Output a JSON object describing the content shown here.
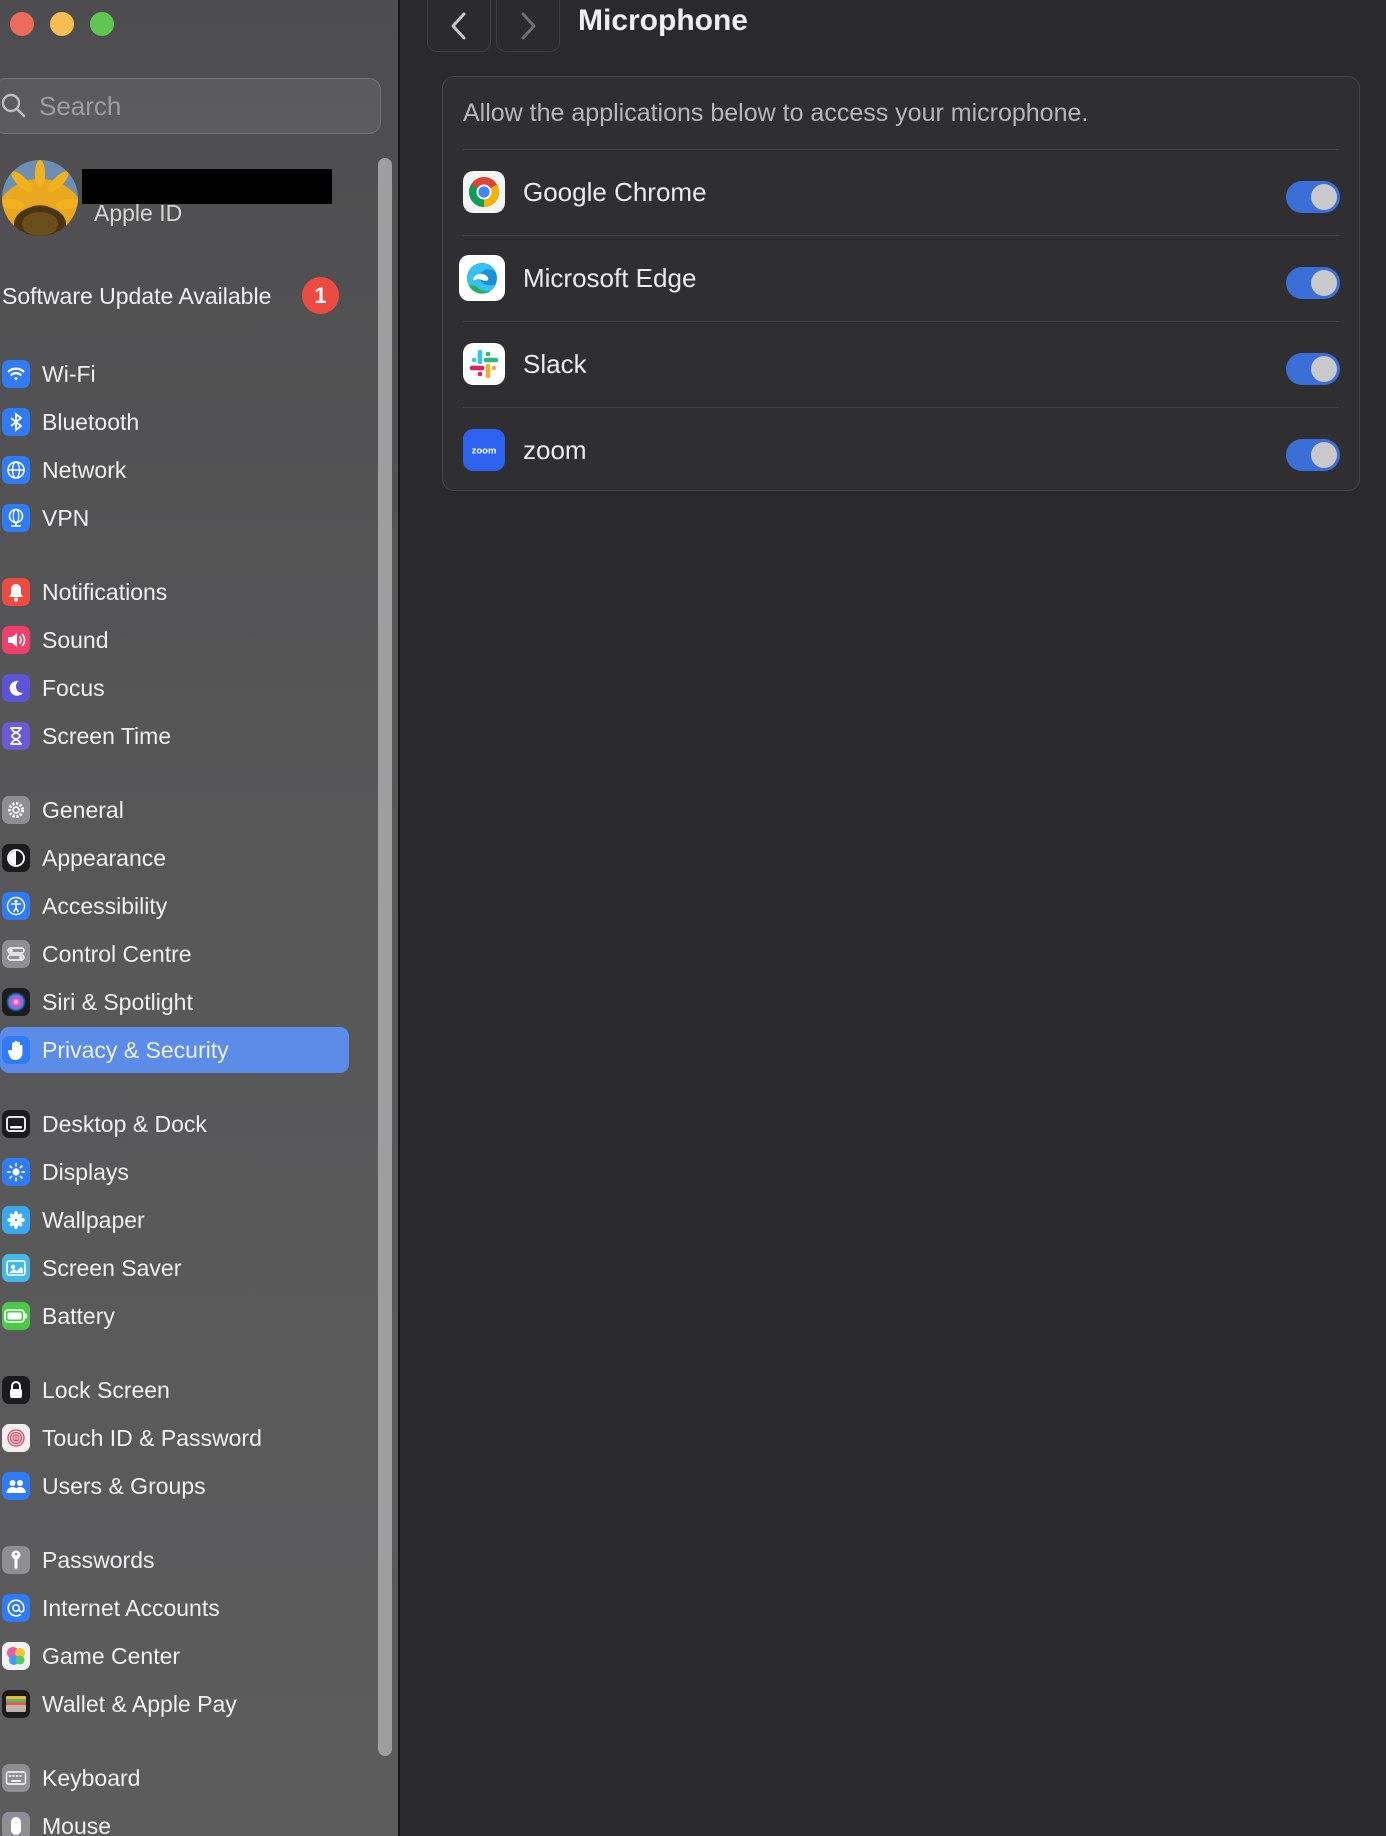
{
  "window": {
    "title": "Microphone"
  },
  "sidebar": {
    "search": {
      "placeholder": "Search"
    },
    "profile": {
      "subtitle": "Apple ID"
    },
    "update": {
      "label": "Software Update Available",
      "count": "1"
    },
    "items": [
      {
        "label": "Wi-Fi",
        "icon": "wifi-icon",
        "color": "#2f7cf6"
      },
      {
        "label": "Bluetooth",
        "icon": "bluetooth-icon",
        "color": "#2f7cf6"
      },
      {
        "label": "Network",
        "icon": "globe-icon",
        "color": "#2f7cf6"
      },
      {
        "label": "VPN",
        "icon": "vpn-globe-icon",
        "color": "#2f7cf6"
      },
      {
        "label": "Notifications",
        "icon": "bell-icon",
        "color": "#ec4b41"
      },
      {
        "label": "Sound",
        "icon": "speaker-icon",
        "color": "#ec3f6a"
      },
      {
        "label": "Focus",
        "icon": "moon-icon",
        "color": "#5b54d6"
      },
      {
        "label": "Screen Time",
        "icon": "hourglass-icon",
        "color": "#6a5ad6"
      },
      {
        "label": "General",
        "icon": "gear-icon",
        "color": "#8e8e93"
      },
      {
        "label": "Appearance",
        "icon": "appearance-icon",
        "color": "#1c1c1e"
      },
      {
        "label": "Accessibility",
        "icon": "accessibility-icon",
        "color": "#2f7cf6"
      },
      {
        "label": "Control Centre",
        "icon": "control-centre-icon",
        "color": "#8e8e93"
      },
      {
        "label": "Siri & Spotlight",
        "icon": "siri-icon",
        "color": "#9b3fd6"
      },
      {
        "label": "Privacy & Security",
        "icon": "hand-icon",
        "color": "#2f7cf6",
        "selected": true
      },
      {
        "label": "Desktop & Dock",
        "icon": "dock-icon",
        "color": "#1c1c1e"
      },
      {
        "label": "Displays",
        "icon": "sun-icon",
        "color": "#2f7cf6"
      },
      {
        "label": "Wallpaper",
        "icon": "flower-icon",
        "color": "#3aa8f0"
      },
      {
        "label": "Screen Saver",
        "icon": "screen-saver-icon",
        "color": "#45b8e8"
      },
      {
        "label": "Battery",
        "icon": "battery-icon",
        "color": "#4cc94a"
      },
      {
        "label": "Lock Screen",
        "icon": "lock-icon",
        "color": "#1c1c1e"
      },
      {
        "label": "Touch ID & Password",
        "icon": "fingerprint-icon",
        "color": "#f3eef0"
      },
      {
        "label": "Users & Groups",
        "icon": "users-icon",
        "color": "#2f7cf6"
      },
      {
        "label": "Passwords",
        "icon": "key-icon",
        "color": "#8e8e93"
      },
      {
        "label": "Internet Accounts",
        "icon": "at-icon",
        "color": "#2f7cf6"
      },
      {
        "label": "Game Center",
        "icon": "game-center-icon",
        "color": "#f2f2f2"
      },
      {
        "label": "Wallet & Apple Pay",
        "icon": "wallet-icon",
        "color": "#1c1c1e"
      },
      {
        "label": "Keyboard",
        "icon": "keyboard-icon",
        "color": "#8e8e93"
      },
      {
        "label": "Mouse",
        "icon": "mouse-icon",
        "color": "#8e8e93"
      }
    ]
  },
  "main": {
    "title": "Microphone",
    "description": "Allow the applications below to access your microphone.",
    "apps": [
      {
        "name": "Google Chrome",
        "icon": "chrome-icon",
        "enabled": true
      },
      {
        "name": "Microsoft Edge",
        "icon": "edge-icon",
        "enabled": true
      },
      {
        "name": "Slack",
        "icon": "slack-icon",
        "enabled": true
      },
      {
        "name": "zoom",
        "icon": "zoom-icon",
        "icon_text": "zoom",
        "enabled": true
      }
    ]
  },
  "colors": {
    "accent": "#3b6fd8",
    "selection": "#5b8de8",
    "badge": "#ec4b41",
    "background": "#2a2a2c"
  }
}
